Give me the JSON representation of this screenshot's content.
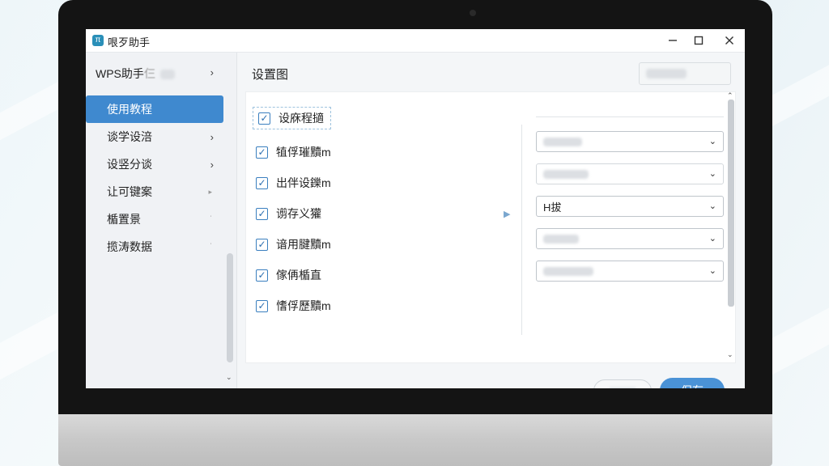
{
  "window": {
    "title": "哏歹助手",
    "controls": [
      "minimize-icon",
      "maximize-icon",
      "close-icon"
    ]
  },
  "sidebar": {
    "header": "WPS助手",
    "header_suffix": "仨",
    "items": [
      {
        "label": "使用教程",
        "active": true,
        "indicator": ""
      },
      {
        "label": "谈学设涪",
        "active": false,
        "indicator": "chevron-right"
      },
      {
        "label": "设竖分谈",
        "active": false,
        "indicator": "chevron-right"
      },
      {
        "label": "让可键案",
        "active": false,
        "indicator": "triangle-right"
      },
      {
        "label": "楯置景",
        "active": false,
        "indicator": "tick"
      },
      {
        "label": "揽涛数据",
        "active": false,
        "indicator": "tick"
      }
    ]
  },
  "content": {
    "title": "设置图",
    "checkboxes": [
      {
        "label": "设庥程擿",
        "checked": true
      },
      {
        "label": "犆俘璀黷m",
        "checked": true
      },
      {
        "label": "出伴设鑠m",
        "checked": true
      },
      {
        "label": "谫存义獾",
        "checked": true
      },
      {
        "label": "谙用腱黷m",
        "checked": true
      },
      {
        "label": "傢侢楯直",
        "checked": true
      },
      {
        "label": "愭俘歷黷m",
        "checked": true
      }
    ],
    "selects": [
      {
        "value": ""
      },
      {
        "value": ""
      },
      {
        "value": "H拔"
      },
      {
        "value": ""
      },
      {
        "value": ""
      }
    ]
  },
  "footer": {
    "save_label": "保存"
  },
  "colors": {
    "accent": "#4a92d6",
    "sidebar_active": "#3f89cf",
    "checkbox": "#3a7fbf"
  }
}
